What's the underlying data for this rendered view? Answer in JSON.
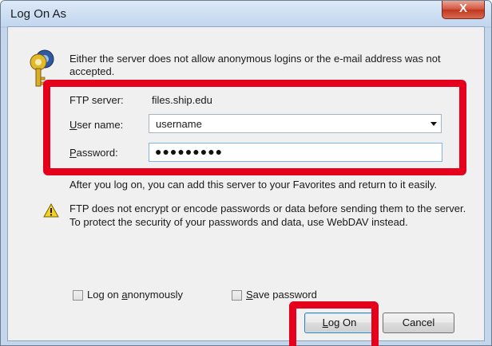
{
  "window": {
    "title": "Log On As",
    "close_label": "X"
  },
  "message": "Either the server does not allow anonymous logins or the e-mail address was not accepted.",
  "ftp_server": {
    "label": "FTP server:",
    "value": "files.ship.edu"
  },
  "user_name": {
    "label_pre": "",
    "label_mnemonic": "U",
    "label_post": "ser name:",
    "value": "username"
  },
  "password": {
    "label_mnemonic": "P",
    "label_post": "assword:",
    "masked_value": "●●●●●●●●●"
  },
  "favorites_note": "After you log on, you can add this server to your Favorites and return to it easily.",
  "warning_text": "FTP does not encrypt or encode passwords or data before sending them to the server.  To protect the security of your passwords and data, use WebDAV instead.",
  "options": {
    "anonymous": {
      "label_pre": "Log on ",
      "label_mnemonic": "a",
      "label_post": "nonymously",
      "checked": false
    },
    "save_password": {
      "label_pre": "",
      "label_mnemonic": "S",
      "label_post": "ave password",
      "checked": false
    }
  },
  "buttons": {
    "log_on_pre": "",
    "log_on_mnemonic": "L",
    "log_on_post": "og On",
    "cancel": "Cancel"
  },
  "highlight_color": "#e5001c"
}
